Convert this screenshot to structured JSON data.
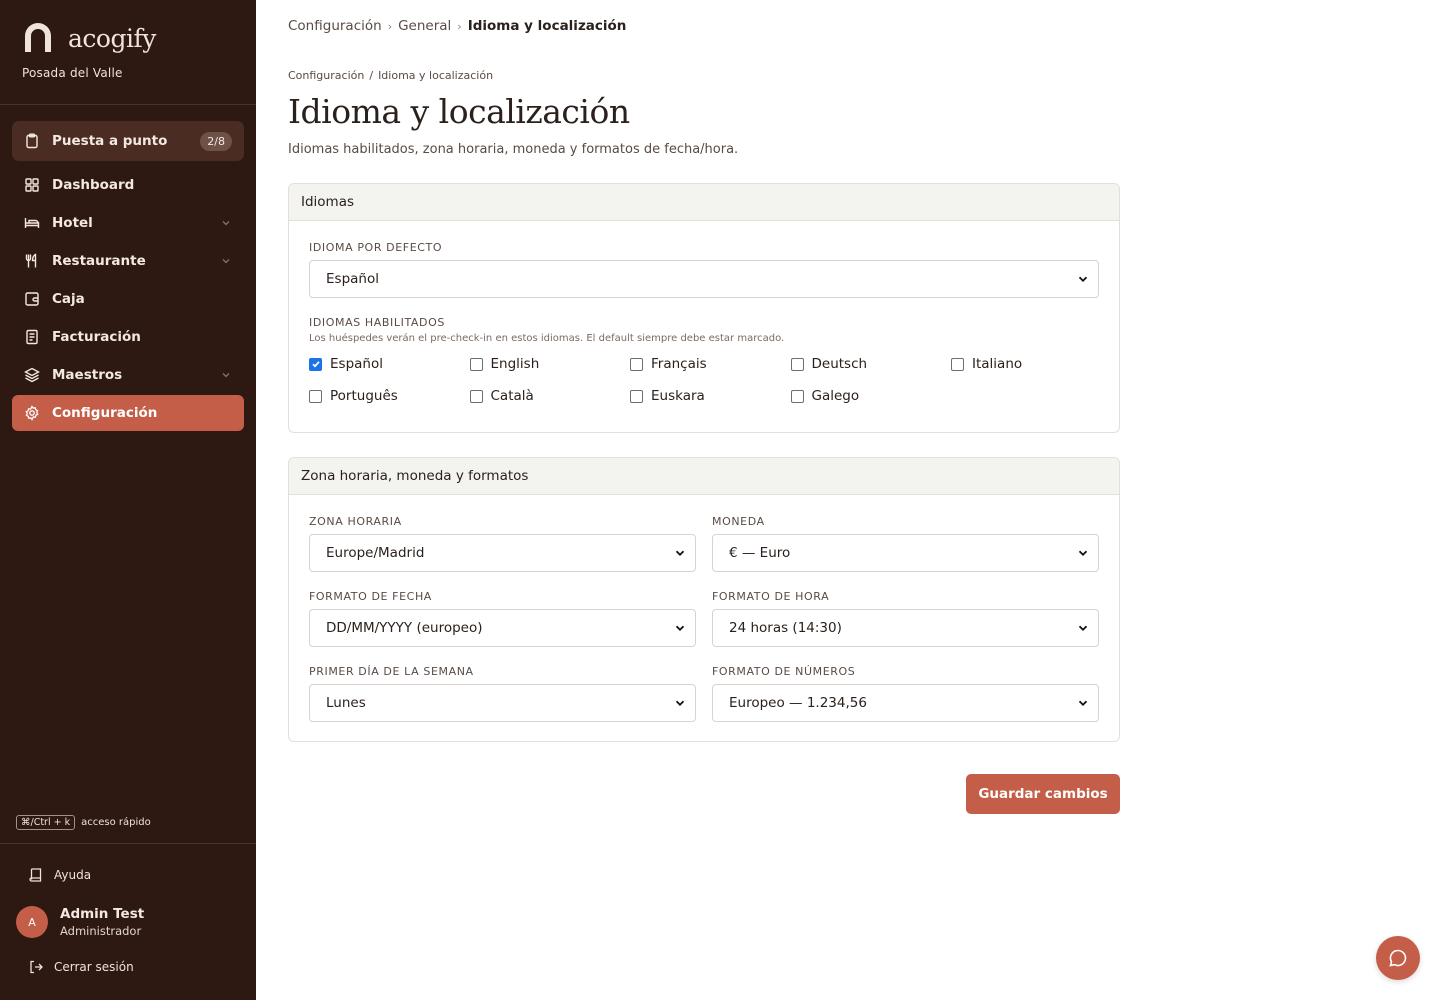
{
  "brand": {
    "name": "acogify",
    "property": "Posada del Valle"
  },
  "setup": {
    "label": "Puesta a punto",
    "badge": "2/8"
  },
  "nav": [
    {
      "label": "Dashboard",
      "icon": "dashboard-icon"
    },
    {
      "label": "Hotel",
      "icon": "bed-icon"
    },
    {
      "label": "Restaurante",
      "icon": "fork-knife-icon"
    },
    {
      "label": "Caja",
      "icon": "cash-register-icon"
    },
    {
      "label": "Facturación",
      "icon": "invoice-icon"
    },
    {
      "label": "Maestros",
      "icon": "layers-icon"
    },
    {
      "label": "Configuración",
      "icon": "gear-icon"
    }
  ],
  "shortcut": {
    "key": "⌘/Ctrl + k",
    "label": "acceso rápido"
  },
  "help": {
    "label": "Ayuda"
  },
  "user": {
    "initial": "A",
    "name": "Admin Test",
    "role": "Administrador"
  },
  "logout": {
    "label": "Cerrar sesión"
  },
  "topcrumbs": [
    "Configuración",
    "General",
    "Idioma y localización"
  ],
  "crumbs": [
    "Configuración",
    "Idioma y localización"
  ],
  "page": {
    "title": "Idioma y localización",
    "subtitle": "Idiomas habilitados, zona horaria, moneda y formatos de fecha/hora."
  },
  "languages_card": {
    "title": "Idiomas",
    "default_label": "Idioma por defecto",
    "default_value": "Español",
    "enabled_label": "Idiomas habilitados",
    "enabled_hint": "Los huéspedes verán el pre-check-in en estos idiomas. El default siempre debe estar marcado.",
    "languages": [
      {
        "label": "Español",
        "checked": true
      },
      {
        "label": "English",
        "checked": false
      },
      {
        "label": "Français",
        "checked": false
      },
      {
        "label": "Deutsch",
        "checked": false
      },
      {
        "label": "Italiano",
        "checked": false
      },
      {
        "label": "Português",
        "checked": false
      },
      {
        "label": "Català",
        "checked": false
      },
      {
        "label": "Euskara",
        "checked": false
      },
      {
        "label": "Galego",
        "checked": false
      }
    ]
  },
  "formats_card": {
    "title": "Zona horaria, moneda y formatos",
    "timezone": {
      "label": "Zona horaria",
      "value": "Europe/Madrid"
    },
    "currency": {
      "label": "Moneda",
      "value": "€ — Euro"
    },
    "date_format": {
      "label": "Formato de fecha",
      "value": "DD/MM/YYYY (europeo)"
    },
    "time_format": {
      "label": "Formato de hora",
      "value": "24 horas (14:30)"
    },
    "week_start": {
      "label": "Primer día de la semana",
      "value": "Lunes"
    },
    "number_format": {
      "label": "Formato de números",
      "value": "Europeo — 1.234,56"
    }
  },
  "save_label": "Guardar cambios",
  "colors": {
    "sidebar": "#2d1812",
    "accent": "#c45e48",
    "setup_bg": "#4a2c22"
  }
}
